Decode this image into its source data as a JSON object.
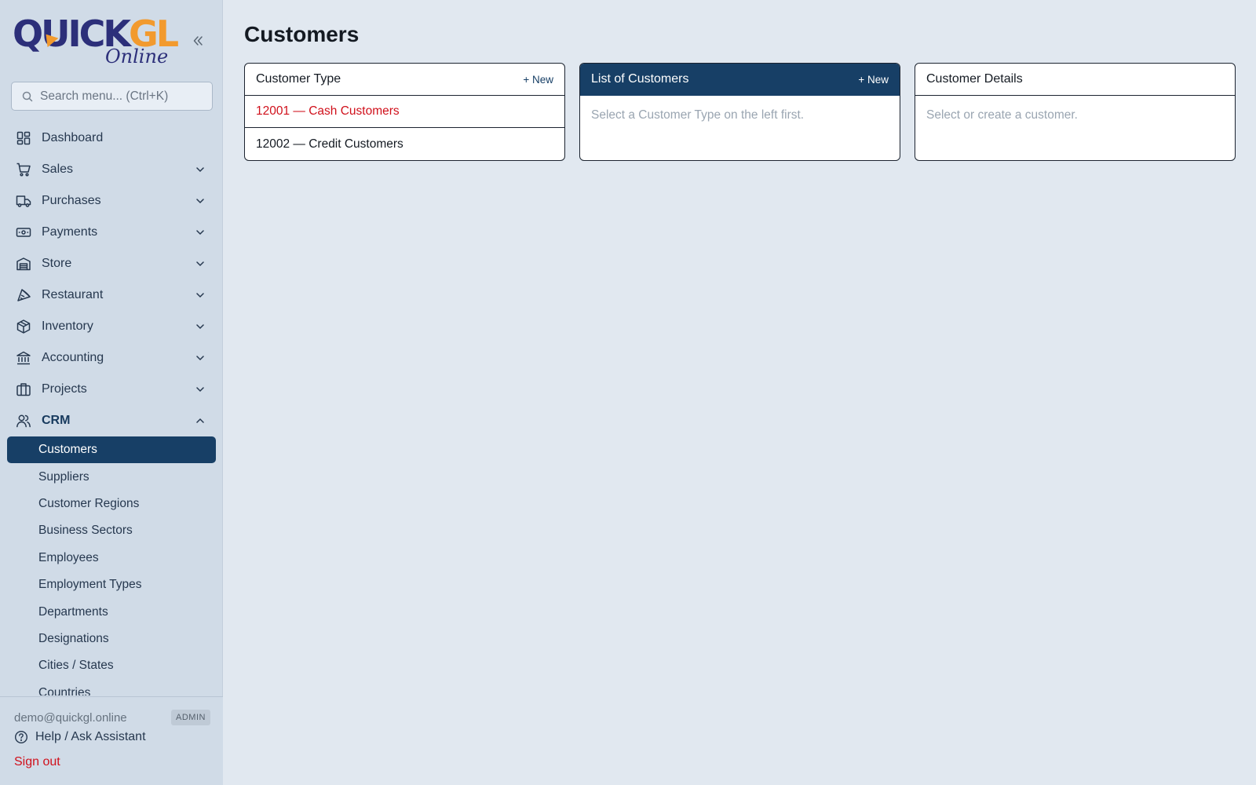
{
  "brand": {
    "logo_main_a": "QUICK",
    "logo_main_b": "GL",
    "logo_sub": "Online"
  },
  "search": {
    "placeholder": "Search menu... (Ctrl+K)"
  },
  "nav": {
    "items": [
      {
        "label": "Dashboard",
        "icon": "dashboard-icon"
      },
      {
        "label": "Sales",
        "icon": "cart-icon"
      },
      {
        "label": "Purchases",
        "icon": "truck-icon"
      },
      {
        "label": "Payments",
        "icon": "banknote-icon"
      },
      {
        "label": "Store",
        "icon": "warehouse-icon"
      },
      {
        "label": "Restaurant",
        "icon": "restaurant-icon"
      },
      {
        "label": "Inventory",
        "icon": "box-icon"
      },
      {
        "label": "Accounting",
        "icon": "bank-icon"
      },
      {
        "label": "Projects",
        "icon": "briefcase-icon"
      },
      {
        "label": "CRM",
        "icon": "users-icon"
      }
    ],
    "crm_sub": [
      "Customers",
      "Suppliers",
      "Customer Regions",
      "Business Sectors",
      "Employees",
      "Employment Types",
      "Departments",
      "Designations",
      "Cities / States",
      "Countries"
    ]
  },
  "footer": {
    "email": "demo@quickgl.online",
    "role": "ADMIN",
    "help": "Help / Ask Assistant",
    "signout": "Sign out"
  },
  "page": {
    "title": "Customers"
  },
  "panels": {
    "types": {
      "title": "Customer Type",
      "new_label": "+ New",
      "rows": [
        "12001 — Cash Customers",
        "12002 — Credit Customers"
      ]
    },
    "list": {
      "title": "List of Customers",
      "new_label": "+ New",
      "empty": "Select a Customer Type on the left first."
    },
    "details": {
      "title": "Customer Details",
      "empty": "Select or create a customer."
    }
  },
  "colors": {
    "accent": "#173f66",
    "danger": "#d0101b",
    "logo_blue": "#2c2f7a",
    "logo_orange": "#f29a2e"
  }
}
